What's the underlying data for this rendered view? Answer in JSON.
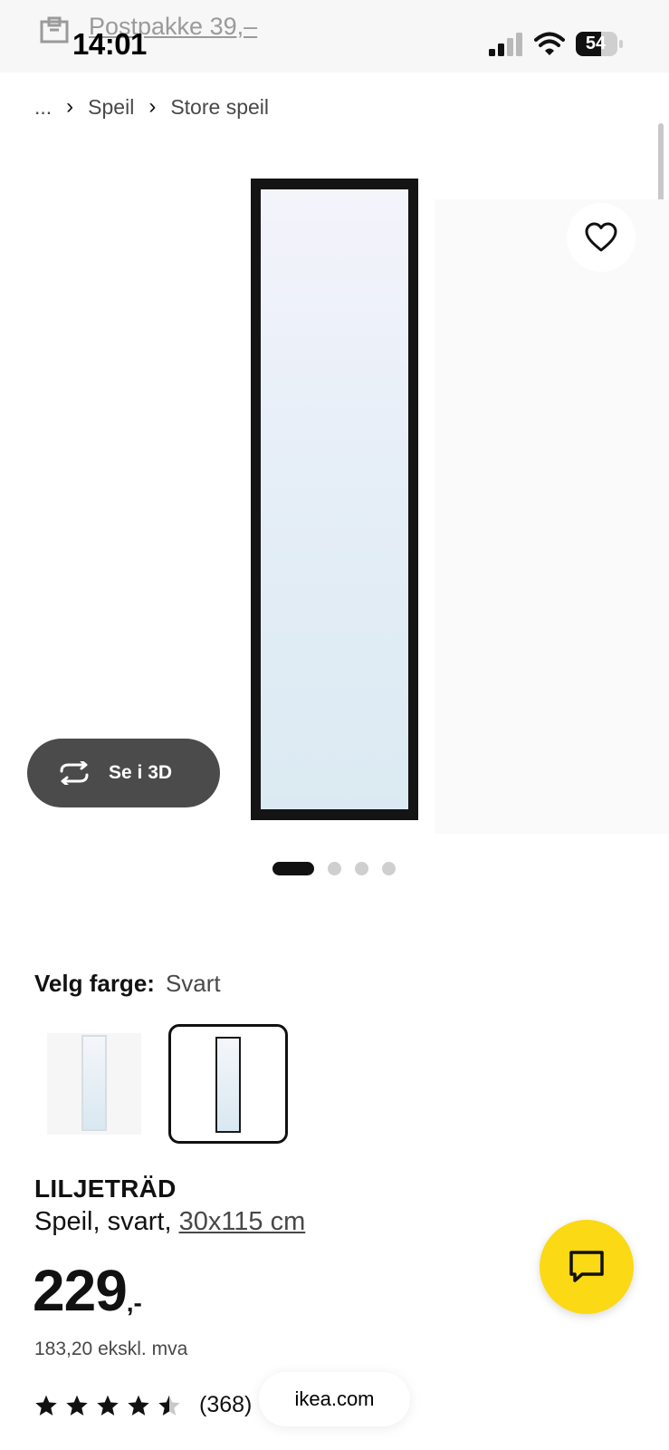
{
  "status_bar": {
    "parcel_text": "Postpakke 39,–",
    "time": "14:01",
    "battery": "54"
  },
  "breadcrumb": {
    "items": [
      "...",
      "Speil",
      "Store speil"
    ]
  },
  "gallery": {
    "see_3d_label": "Se i 3D",
    "image_count": 4,
    "active_index": 0
  },
  "color": {
    "label": "Velg farge:",
    "selected": "Svart",
    "options": [
      "white",
      "black"
    ]
  },
  "product": {
    "name": "LILJETRÄD",
    "desc_prefix": "Speil, svart, ",
    "size": "30x115 cm",
    "price_int": "229",
    "price_dec": ",-",
    "price_ex_vat": "183,20 ekskl. mva",
    "rating_stars": 4.5,
    "rating_count": "(368)"
  },
  "browser": {
    "url": "ikea.com"
  },
  "colors": {
    "chat_yellow": "#fbd914",
    "button_dark": "#4b4b4b"
  }
}
